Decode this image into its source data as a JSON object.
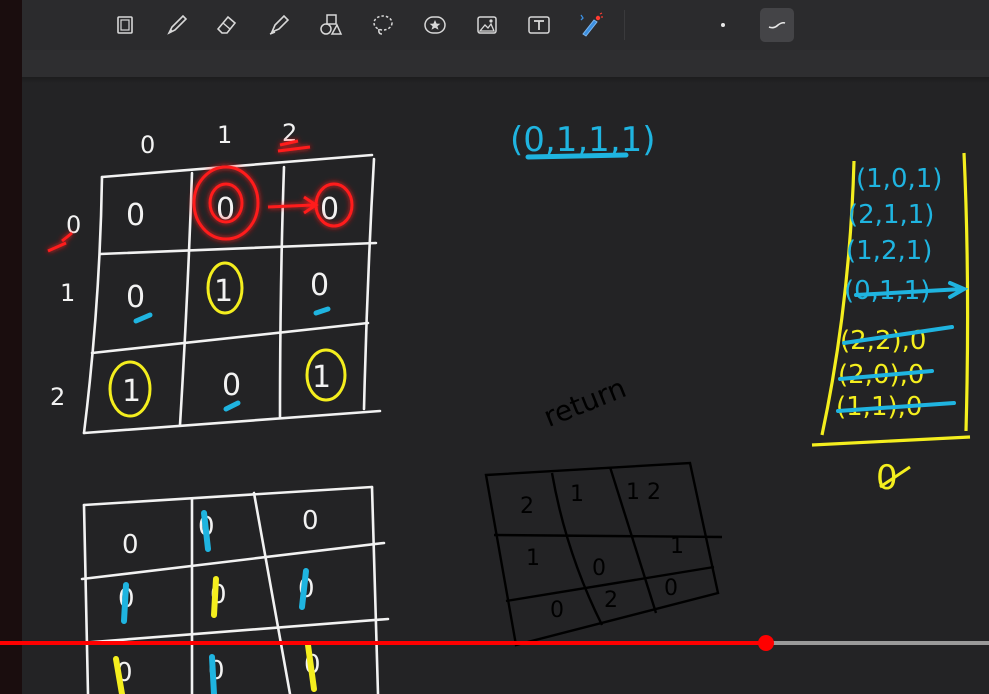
{
  "toolbar": {
    "tools": [
      {
        "name": "page-tool",
        "icon": "page-icon"
      },
      {
        "name": "pen-tool",
        "icon": "pen-icon"
      },
      {
        "name": "eraser-tool",
        "icon": "eraser-icon"
      },
      {
        "name": "highlighter-tool",
        "icon": "highlighter-icon"
      },
      {
        "name": "shapes-tool",
        "icon": "shapes-icon"
      },
      {
        "name": "lasso-tool",
        "icon": "lasso-icon"
      },
      {
        "name": "sticker-tool",
        "icon": "star-sticker-icon"
      },
      {
        "name": "image-tool",
        "icon": "image-icon"
      },
      {
        "name": "text-tool",
        "icon": "text-icon"
      },
      {
        "name": "laser-pointer-tool",
        "icon": "laser-pointer-icon"
      },
      {
        "name": "pen-size-tool",
        "icon": "dot-icon"
      },
      {
        "name": "stroke-style-tool",
        "icon": "stroke-icon"
      }
    ],
    "active_tool": "stroke-style-tool"
  },
  "colors": {
    "canvas": "#232325",
    "ink_white": "#f2f2f2",
    "ink_red": "#ff1a1a",
    "ink_yellow": "#f4ee1e",
    "ink_blue": "#1fb4e0",
    "ink_black": "#000000"
  },
  "board": {
    "top_grid": {
      "col_headers": [
        "0",
        "1",
        "2"
      ],
      "row_headers": [
        "0",
        "1",
        "2"
      ],
      "cells": [
        [
          "0",
          "0",
          "0"
        ],
        [
          "0",
          "1",
          "0"
        ],
        [
          "1",
          "0",
          "1"
        ]
      ]
    },
    "tuple_note": "(0,1,1,1)",
    "queue": {
      "items": [
        "(1,0,1)",
        "(2,1,1)",
        "(1,2,1)",
        "(0,1,1)",
        "(2,2),0",
        "(2,0),0",
        "(1,1),0"
      ],
      "result": "0"
    },
    "return_note": "return",
    "bottom_grid": {
      "cells": [
        [
          "0",
          "0",
          "0"
        ],
        [
          "0",
          "0",
          "0"
        ],
        [
          "0",
          "0",
          "0"
        ]
      ]
    },
    "black_grid": {
      "cells": [
        [
          "2",
          "1",
          "1 2"
        ],
        [
          "1",
          "0",
          "1"
        ],
        [
          "0",
          "2",
          "0"
        ]
      ]
    }
  },
  "progress": {
    "fraction": 0.775
  }
}
